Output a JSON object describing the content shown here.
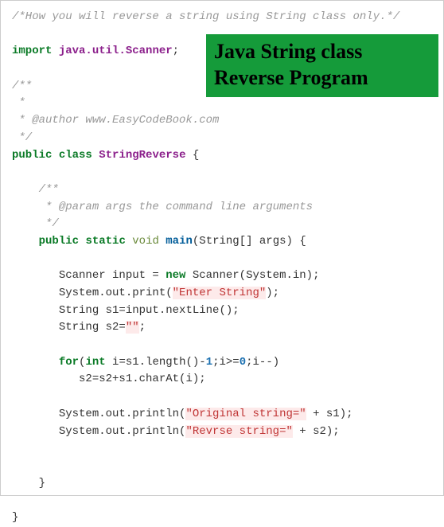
{
  "banner": {
    "line1": "Java String class",
    "line2": "Reverse Program"
  },
  "code": {
    "comment_top": "/*How you will reverse a string using String class only.*/",
    "import_kw": "import",
    "import_pkg": "java.util.Scanner",
    "doc1_open": "/**",
    "doc1_star": " *",
    "doc1_author": " * @author www.EasyCodeBook.com",
    "doc1_close": " */",
    "public_kw": "public",
    "class_kw": "class",
    "class_name": "StringReverse",
    "brace_open": "{",
    "doc2_open": "/**",
    "doc2_param": " * @param args the command line arguments",
    "doc2_close": " */",
    "static_kw": "static",
    "void_kw": "void",
    "main_name": "main",
    "main_params": "(String[] args)",
    "scanner_decl_a": "Scanner input = ",
    "new_kw": "new",
    "scanner_decl_b": " Scanner(System.in);",
    "sout_print": "System.out.print(",
    "str_enter": "\"Enter String\"",
    "close_paren_semi": ");",
    "s1_decl": "String s1=input.nextLine();",
    "s2_decl_a": "String s2=",
    "str_empty": "\"\"",
    "semi": ";",
    "for_kw": "for",
    "int_kw": "int",
    "for_a": "(",
    "for_b": " i=s1.length()-",
    "num_1": "1",
    "for_c": ";i>=",
    "num_0": "0",
    "for_d": ";i--)",
    "for_body": "   s2=s2+s1.charAt(i);",
    "sout_println": "System.out.println(",
    "str_original": "\"Original string=\"",
    "plus_s1": " + s1);",
    "str_reverse": "\"Revrse string=\"",
    "plus_s2": " + s2);",
    "brace_close": "}"
  }
}
